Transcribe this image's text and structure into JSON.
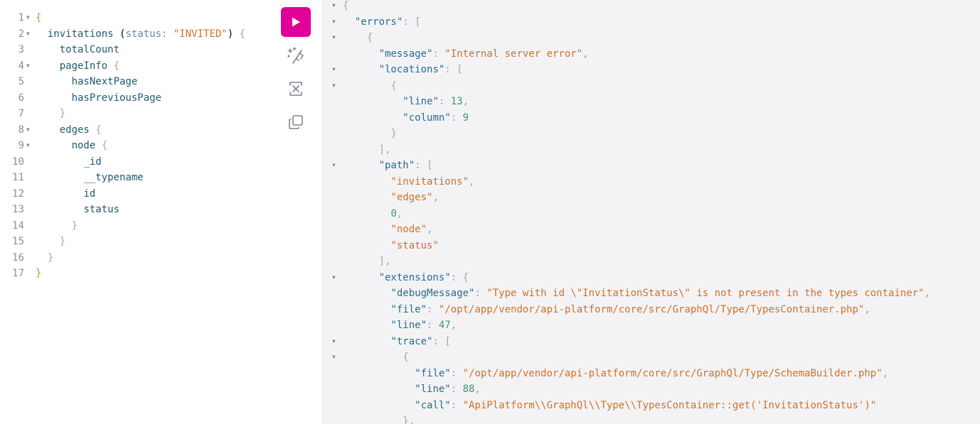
{
  "colors": {
    "run_button": "#e10098",
    "string": "#cf7227",
    "number": "#3d9a6a",
    "key": "#2a6c8c"
  },
  "toolbar": {
    "run_icon": "play-icon",
    "prettify_icon": "prettify-sparkle-icon",
    "merge_icon": "merge-fragments-icon",
    "copy_icon": "copy-icon"
  },
  "query_editor": {
    "lines": [
      {
        "n": "1",
        "fold": true,
        "tokens": [
          {
            "t": "{",
            "c": "c-brace-top"
          }
        ]
      },
      {
        "n": "2",
        "fold": true,
        "tokens": [
          {
            "t": "  "
          },
          {
            "t": "invitations",
            "c": "c-field"
          },
          {
            "t": " ("
          },
          {
            "t": "status",
            "c": "c-arg"
          },
          {
            "t": ": ",
            "c": "c-arg"
          },
          {
            "t": "\"INVITED\"",
            "c": "c-str"
          },
          {
            "t": ") "
          },
          {
            "t": "{",
            "c": "c-brace"
          }
        ]
      },
      {
        "n": "3",
        "fold": false,
        "tokens": [
          {
            "t": "    "
          },
          {
            "t": "totalCount",
            "c": "c-field"
          }
        ]
      },
      {
        "n": "4",
        "fold": true,
        "tokens": [
          {
            "t": "    "
          },
          {
            "t": "pageInfo",
            "c": "c-field"
          },
          {
            "t": " "
          },
          {
            "t": "{",
            "c": "c-brace"
          }
        ]
      },
      {
        "n": "5",
        "fold": false,
        "tokens": [
          {
            "t": "      "
          },
          {
            "t": "hasNextPage",
            "c": "c-field"
          }
        ]
      },
      {
        "n": "6",
        "fold": false,
        "tokens": [
          {
            "t": "      "
          },
          {
            "t": "hasPreviousPage",
            "c": "c-field"
          }
        ]
      },
      {
        "n": "7",
        "fold": false,
        "tokens": [
          {
            "t": "    "
          },
          {
            "t": "}",
            "c": "c-brace"
          }
        ]
      },
      {
        "n": "8",
        "fold": true,
        "tokens": [
          {
            "t": "    "
          },
          {
            "t": "edges",
            "c": "c-field"
          },
          {
            "t": " "
          },
          {
            "t": "{",
            "c": "c-brace"
          }
        ]
      },
      {
        "n": "9",
        "fold": true,
        "tokens": [
          {
            "t": "      "
          },
          {
            "t": "node",
            "c": "c-field"
          },
          {
            "t": " "
          },
          {
            "t": "{",
            "c": "c-brace"
          }
        ]
      },
      {
        "n": "10",
        "fold": false,
        "tokens": [
          {
            "t": "        "
          },
          {
            "t": "_id",
            "c": "c-field"
          }
        ]
      },
      {
        "n": "11",
        "fold": false,
        "tokens": [
          {
            "t": "        "
          },
          {
            "t": "__typename",
            "c": "c-field"
          }
        ]
      },
      {
        "n": "12",
        "fold": false,
        "tokens": [
          {
            "t": "        "
          },
          {
            "t": "id",
            "c": "c-field"
          }
        ]
      },
      {
        "n": "13",
        "fold": false,
        "tokens": [
          {
            "t": "        "
          },
          {
            "t": "status",
            "c": "c-field"
          }
        ]
      },
      {
        "n": "14",
        "fold": false,
        "tokens": [
          {
            "t": "      "
          },
          {
            "t": "}",
            "c": "c-brace"
          }
        ]
      },
      {
        "n": "15",
        "fold": false,
        "tokens": [
          {
            "t": "    "
          },
          {
            "t": "}",
            "c": "c-brace"
          }
        ]
      },
      {
        "n": "16",
        "fold": false,
        "tokens": [
          {
            "t": "  "
          },
          {
            "t": "}",
            "c": "c-brace"
          }
        ]
      },
      {
        "n": "17",
        "fold": false,
        "tokens": [
          {
            "t": "}",
            "c": "c-brace-top"
          }
        ]
      }
    ]
  },
  "result_viewer": {
    "lines": [
      {
        "fold": true,
        "tokens": [
          {
            "t": "{",
            "c": "c-brace"
          }
        ]
      },
      {
        "fold": true,
        "tokens": [
          {
            "t": "  "
          },
          {
            "t": "\"errors\"",
            "c": "c-key"
          },
          {
            "t": ": ",
            "c": "c-punc"
          },
          {
            "t": "[",
            "c": "c-brace"
          }
        ]
      },
      {
        "fold": true,
        "tokens": [
          {
            "t": "    "
          },
          {
            "t": "{",
            "c": "c-brace"
          }
        ]
      },
      {
        "fold": false,
        "tokens": [
          {
            "t": "      "
          },
          {
            "t": "\"message\"",
            "c": "c-key"
          },
          {
            "t": ": ",
            "c": "c-punc"
          },
          {
            "t": "\"Internal server error\"",
            "c": "c-str"
          },
          {
            "t": ",",
            "c": "c-punc"
          }
        ]
      },
      {
        "fold": true,
        "tokens": [
          {
            "t": "      "
          },
          {
            "t": "\"locations\"",
            "c": "c-key"
          },
          {
            "t": ": ",
            "c": "c-punc"
          },
          {
            "t": "[",
            "c": "c-brace"
          }
        ]
      },
      {
        "fold": true,
        "tokens": [
          {
            "t": "        "
          },
          {
            "t": "{",
            "c": "c-brace"
          }
        ]
      },
      {
        "fold": false,
        "tokens": [
          {
            "t": "          "
          },
          {
            "t": "\"line\"",
            "c": "c-key"
          },
          {
            "t": ": ",
            "c": "c-punc"
          },
          {
            "t": "13",
            "c": "c-num"
          },
          {
            "t": ",",
            "c": "c-punc"
          }
        ]
      },
      {
        "fold": false,
        "tokens": [
          {
            "t": "          "
          },
          {
            "t": "\"column\"",
            "c": "c-key"
          },
          {
            "t": ": ",
            "c": "c-punc"
          },
          {
            "t": "9",
            "c": "c-num"
          }
        ]
      },
      {
        "fold": false,
        "tokens": [
          {
            "t": "        "
          },
          {
            "t": "}",
            "c": "c-brace"
          }
        ]
      },
      {
        "fold": false,
        "tokens": [
          {
            "t": "      "
          },
          {
            "t": "],",
            "c": "c-brace"
          }
        ]
      },
      {
        "fold": true,
        "tokens": [
          {
            "t": "      "
          },
          {
            "t": "\"path\"",
            "c": "c-key"
          },
          {
            "t": ": ",
            "c": "c-punc"
          },
          {
            "t": "[",
            "c": "c-brace"
          }
        ]
      },
      {
        "fold": false,
        "tokens": [
          {
            "t": "        "
          },
          {
            "t": "\"invitations\"",
            "c": "c-str"
          },
          {
            "t": ",",
            "c": "c-punc"
          }
        ]
      },
      {
        "fold": false,
        "tokens": [
          {
            "t": "        "
          },
          {
            "t": "\"edges\"",
            "c": "c-str"
          },
          {
            "t": ",",
            "c": "c-punc"
          }
        ]
      },
      {
        "fold": false,
        "tokens": [
          {
            "t": "        "
          },
          {
            "t": "0",
            "c": "c-num"
          },
          {
            "t": ",",
            "c": "c-punc"
          }
        ]
      },
      {
        "fold": false,
        "tokens": [
          {
            "t": "        "
          },
          {
            "t": "\"node\"",
            "c": "c-str"
          },
          {
            "t": ",",
            "c": "c-punc"
          }
        ]
      },
      {
        "fold": false,
        "tokens": [
          {
            "t": "        "
          },
          {
            "t": "\"status\"",
            "c": "c-str"
          }
        ]
      },
      {
        "fold": false,
        "tokens": [
          {
            "t": "      "
          },
          {
            "t": "],",
            "c": "c-brace"
          }
        ]
      },
      {
        "fold": true,
        "tokens": [
          {
            "t": "      "
          },
          {
            "t": "\"extensions\"",
            "c": "c-key"
          },
          {
            "t": ": ",
            "c": "c-punc"
          },
          {
            "t": "{",
            "c": "c-brace"
          }
        ]
      },
      {
        "fold": false,
        "tokens": [
          {
            "t": "        "
          },
          {
            "t": "\"debugMessage\"",
            "c": "c-key"
          },
          {
            "t": ": ",
            "c": "c-punc"
          },
          {
            "t": "\"Type with id \\\"InvitationStatus\\\" is not present in the types container\"",
            "c": "c-str"
          },
          {
            "t": ",",
            "c": "c-punc"
          }
        ]
      },
      {
        "fold": false,
        "tokens": [
          {
            "t": "        "
          },
          {
            "t": "\"file\"",
            "c": "c-key"
          },
          {
            "t": ": ",
            "c": "c-punc"
          },
          {
            "t": "\"/opt/app/vendor/api-platform/core/src/GraphQl/Type/TypesContainer.php\"",
            "c": "c-str"
          },
          {
            "t": ",",
            "c": "c-punc"
          }
        ]
      },
      {
        "fold": false,
        "tokens": [
          {
            "t": "        "
          },
          {
            "t": "\"line\"",
            "c": "c-key"
          },
          {
            "t": ": ",
            "c": "c-punc"
          },
          {
            "t": "47",
            "c": "c-num"
          },
          {
            "t": ",",
            "c": "c-punc"
          }
        ]
      },
      {
        "fold": true,
        "tokens": [
          {
            "t": "        "
          },
          {
            "t": "\"trace\"",
            "c": "c-key"
          },
          {
            "t": ": ",
            "c": "c-punc"
          },
          {
            "t": "[",
            "c": "c-brace"
          }
        ]
      },
      {
        "fold": true,
        "tokens": [
          {
            "t": "          "
          },
          {
            "t": "{",
            "c": "c-brace"
          }
        ]
      },
      {
        "fold": false,
        "tokens": [
          {
            "t": "            "
          },
          {
            "t": "\"file\"",
            "c": "c-key"
          },
          {
            "t": ": ",
            "c": "c-punc"
          },
          {
            "t": "\"/opt/app/vendor/api-platform/core/src/GraphQl/Type/SchemaBuilder.php\"",
            "c": "c-str"
          },
          {
            "t": ",",
            "c": "c-punc"
          }
        ]
      },
      {
        "fold": false,
        "tokens": [
          {
            "t": "            "
          },
          {
            "t": "\"line\"",
            "c": "c-key"
          },
          {
            "t": ": ",
            "c": "c-punc"
          },
          {
            "t": "88",
            "c": "c-num"
          },
          {
            "t": ",",
            "c": "c-punc"
          }
        ]
      },
      {
        "fold": false,
        "tokens": [
          {
            "t": "            "
          },
          {
            "t": "\"call\"",
            "c": "c-key"
          },
          {
            "t": ": ",
            "c": "c-punc"
          },
          {
            "t": "\"ApiPlatform\\\\GraphQl\\\\Type\\\\TypesContainer::get('InvitationStatus')\"",
            "c": "c-str"
          }
        ]
      },
      {
        "fold": false,
        "tokens": [
          {
            "t": "          "
          },
          {
            "t": "},",
            "c": "c-brace"
          }
        ]
      }
    ]
  }
}
